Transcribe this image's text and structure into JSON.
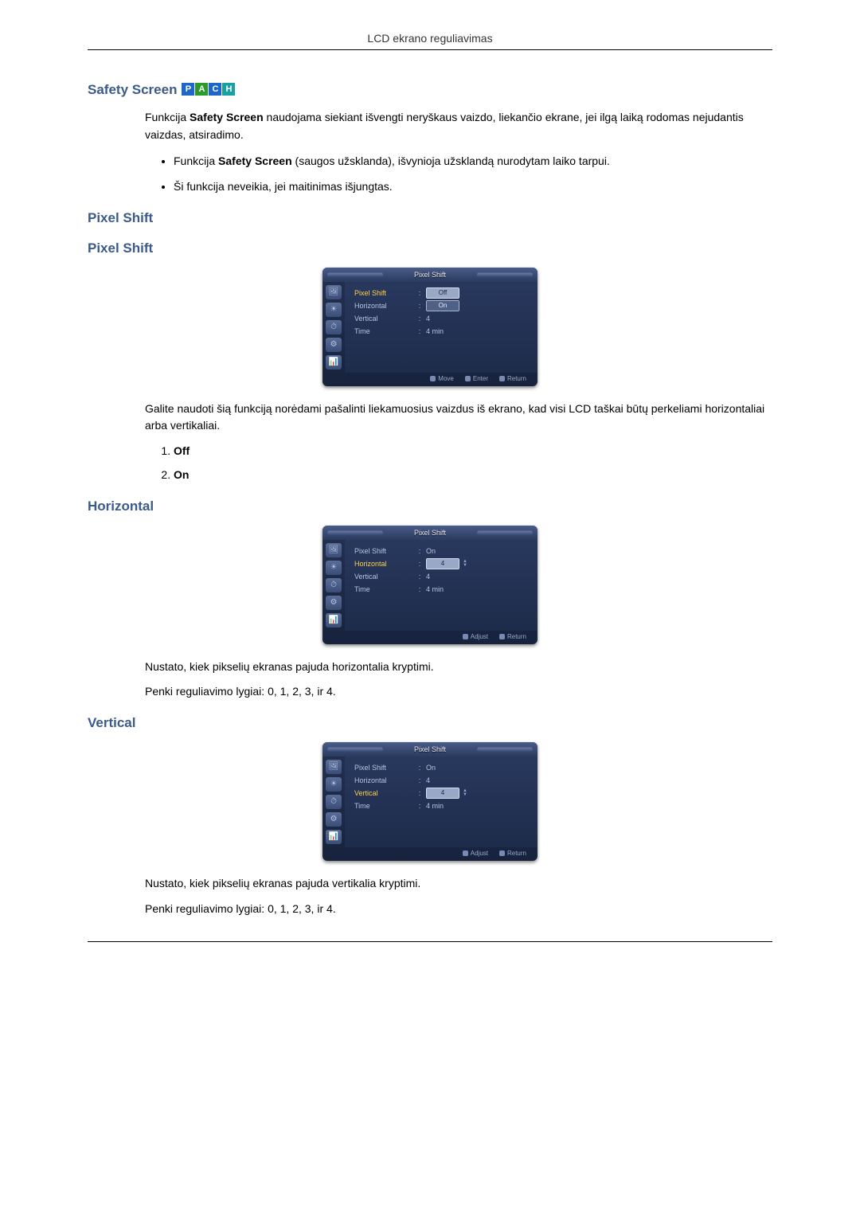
{
  "header": {
    "title": "LCD ekrano reguliavimas"
  },
  "safety_screen": {
    "title": "Safety Screen",
    "badge": {
      "p": "P",
      "a": "A",
      "c": "C",
      "h": "H"
    },
    "intro": "Funkcija Safety Screen naudojama siekiant išvengti neryškaus vaizdo, liekančio ekrane, jei ilgą laiką rodomas nejudantis vaizdas, atsiradimo.",
    "bold_a": "Safety Screen",
    "bullet1_pre": "Funkcija ",
    "bullet1_bold": "Safety Screen",
    "bullet1_post": " (saugos užsklanda), išvynioja užsklandą nurodytam laiko tarpui.",
    "bullet2": "Ši funkcija neveikia, jei maitinimas išjungtas."
  },
  "pixel_shift_heading1": "Pixel Shift",
  "pixel_shift_heading2": "Pixel Shift",
  "osd": {
    "title": "Pixel Shift",
    "row_pixel_shift": "Pixel Shift",
    "row_horizontal": "Horizontal",
    "row_vertical": "Vertical",
    "row_time": "Time",
    "val_off": "Off",
    "val_on": "On",
    "val_4": "4",
    "val_4min": "4 min",
    "foot_move": "Move",
    "foot_enter": "Enter",
    "foot_return": "Return",
    "foot_adjust": "Adjust"
  },
  "pixel_shift_desc": "Galite naudoti šią funkciją norėdami pašalinti liekamuosius vaizdus iš ekrano, kad visi LCD taškai būtų perkeliami horizontaliai arba vertikaliai.",
  "opt_off": "Off",
  "opt_on": "On",
  "horizontal": {
    "title": "Horizontal",
    "desc1": "Nustato, kiek pikselių ekranas pajuda horizontalia kryptimi.",
    "desc2": "Penki reguliavimo lygiai: 0, 1, 2, 3, ir 4."
  },
  "vertical": {
    "title": "Vertical",
    "desc1": "Nustato, kiek pikselių ekranas pajuda vertikalia kryptimi.",
    "desc2": "Penki reguliavimo lygiai: 0, 1, 2, 3, ir 4."
  }
}
